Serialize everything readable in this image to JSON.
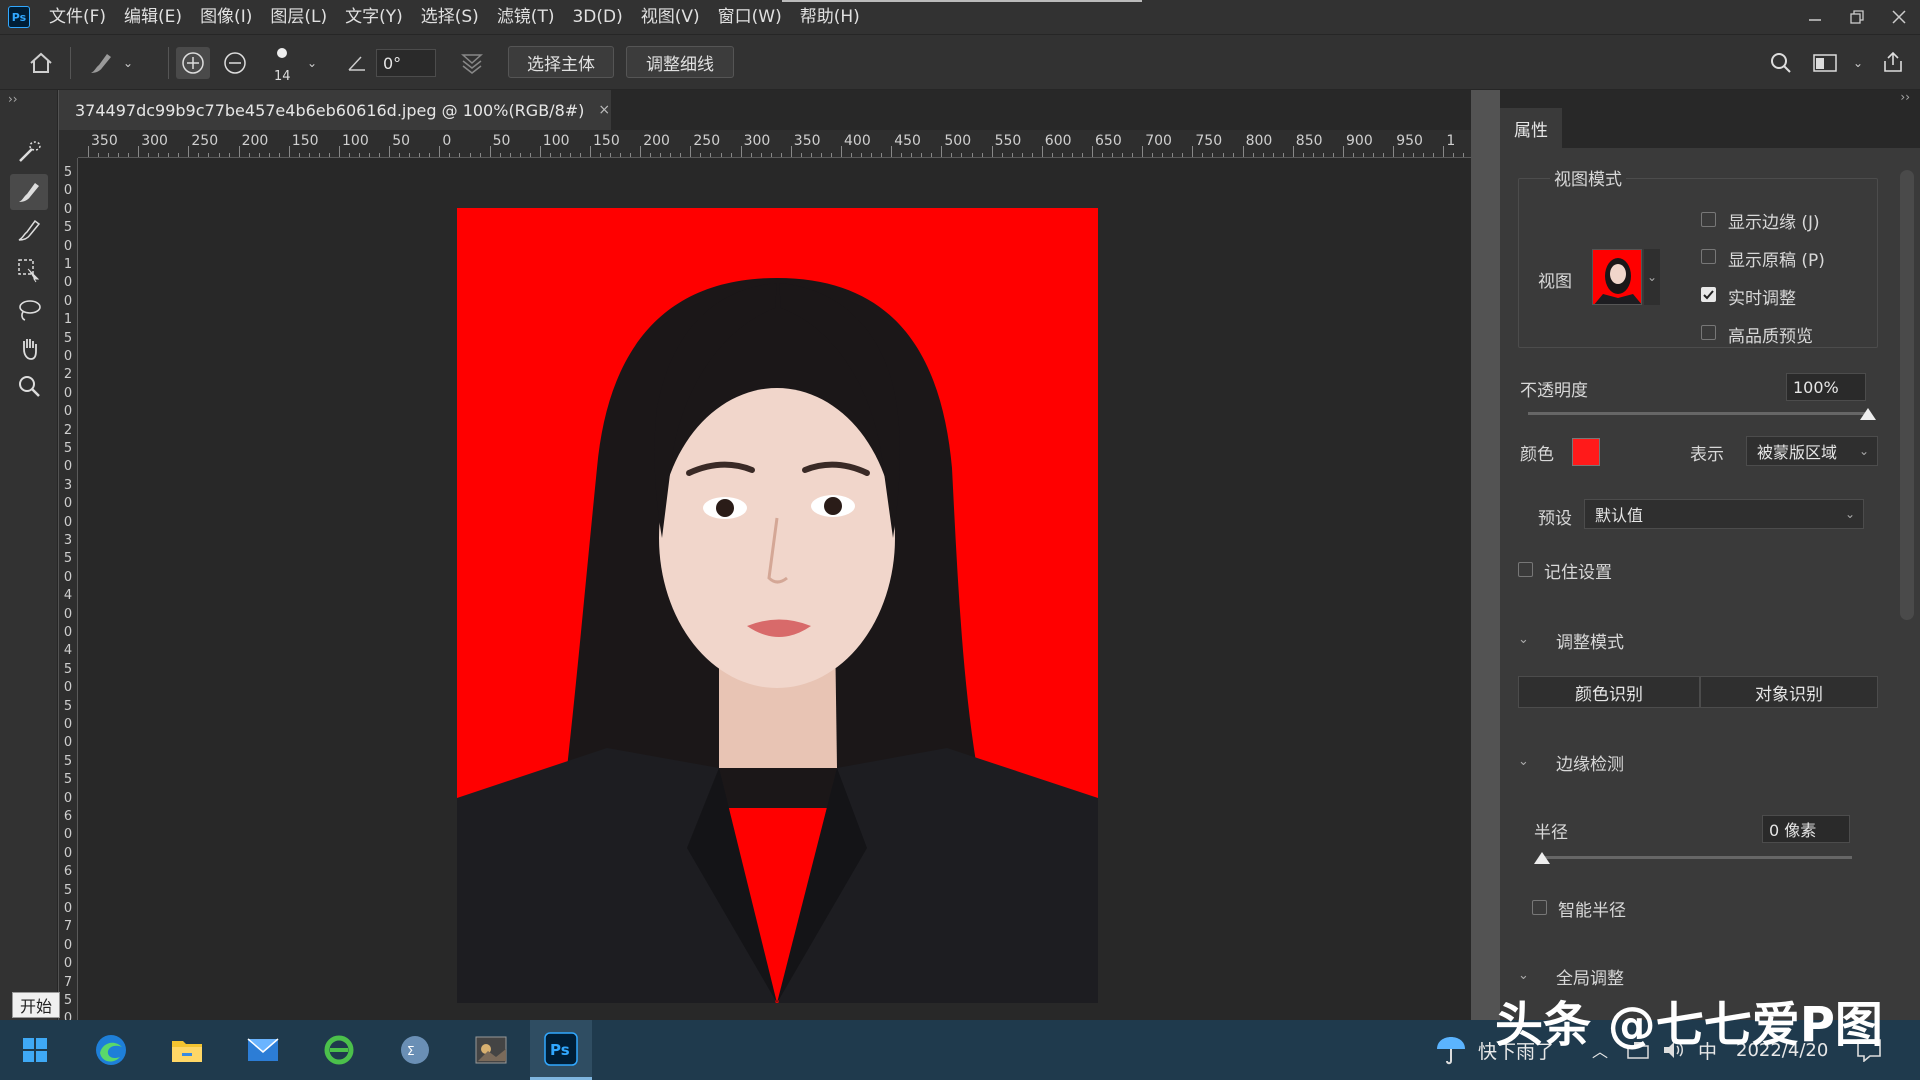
{
  "menu": {
    "logo": "Ps",
    "items": [
      "文件(F)",
      "编辑(E)",
      "图像(I)",
      "图层(L)",
      "文字(Y)",
      "选择(S)",
      "滤镜(T)",
      "3D(D)",
      "视图(V)",
      "窗口(W)",
      "帮助(H)"
    ]
  },
  "options": {
    "brush_size": "14",
    "angle": "0°",
    "select_subject": "选择主体",
    "refine_hair": "调整细线"
  },
  "document": {
    "tab_title": "374497dc99b9c77be457e4b6eb60616d.jpeg @ 100%(RGB/8#)",
    "close": "×"
  },
  "rulers": {
    "h_labels": [
      "350",
      "300",
      "250",
      "200",
      "150",
      "100",
      "50",
      "0",
      "50",
      "100",
      "150",
      "200",
      "250",
      "300",
      "350",
      "400",
      "450",
      "500",
      "550",
      "600",
      "650",
      "700",
      "750",
      "800",
      "850",
      "900",
      "950",
      "1"
    ],
    "v_labels": [
      "5",
      "0",
      "0",
      "5",
      "0",
      "1",
      "0",
      "0",
      "1",
      "5",
      "0",
      "2",
      "0",
      "0",
      "2",
      "5",
      "0",
      "3",
      "0",
      "0",
      "3",
      "5",
      "0",
      "4",
      "0",
      "0",
      "4",
      "5",
      "0",
      "5",
      "0",
      "0",
      "5",
      "5",
      "0",
      "6",
      "0",
      "0",
      "6",
      "5",
      "0",
      "7",
      "0",
      "0",
      "7",
      "5",
      "0"
    ]
  },
  "panel": {
    "tab": "属性",
    "view_mode": "视图模式",
    "view_label": "视图",
    "show_edge": "显示边缘 (J)",
    "show_original": "显示原稿 (P)",
    "realtime": "实时调整",
    "hq_preview": "高品质预览",
    "opacity_label": "不透明度",
    "opacity_value": "100%",
    "opacity": 1.0,
    "color_label": "颜色",
    "overlay_color": "#ff1a1a",
    "indicate_label": "表示",
    "indicate_value": "被蒙版区域",
    "preset_label": "预设",
    "preset_value": "默认值",
    "remember": "记住设置",
    "adjust_mode": "调整模式",
    "color_aware": "颜色识别",
    "object_aware": "对象识别",
    "edge_detection": "边缘检测",
    "radius_label": "半径",
    "radius_value": "0 像素",
    "radius": 0,
    "smart_radius": "智能半径",
    "global_adjust": "全局调整"
  },
  "taskbar": {
    "start_tooltip": "开始",
    "weather": "快下雨了",
    "ime": "中",
    "date": "2022/4/20"
  },
  "watermark": "头条 @七七爱P图",
  "colors": {
    "photo_bg": "#ff0000",
    "accent": "#31a8ff"
  }
}
